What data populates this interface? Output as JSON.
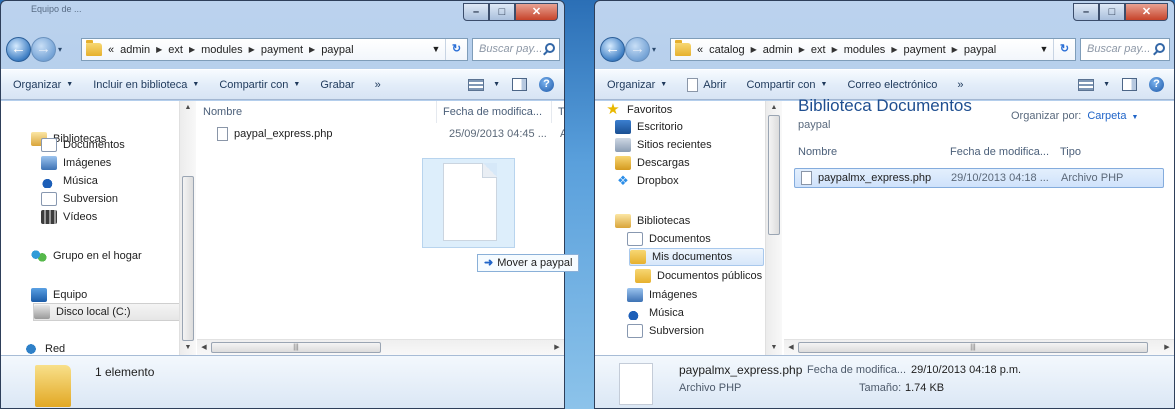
{
  "left": {
    "title": "Equipo de ... ",
    "address": {
      "prefix": "«",
      "crumbs": [
        "admin",
        "ext",
        "modules",
        "payment",
        "paypal"
      ]
    },
    "search_placeholder": "Buscar pay...",
    "toolbar": {
      "organize": "Organizar",
      "include": "Incluir en biblioteca",
      "share": "Compartir con",
      "burn": "Grabar",
      "more": "»"
    },
    "nav": {
      "libraries": "Bibliotecas",
      "documents": "Documentos",
      "images": "Imágenes",
      "music": "Música",
      "subversion": "Subversion",
      "videos": "Vídeos",
      "homegroup": "Grupo en el hogar",
      "computer": "Equipo",
      "local_disk": "Disco local (C:)",
      "network": "Red"
    },
    "columns": {
      "name": "Nombre",
      "modified": "Fecha de modifica...",
      "type": "Tip"
    },
    "files": [
      {
        "name": "paypal_express.php",
        "modified": "25/09/2013 04:45 ...",
        "type": "Ar"
      }
    ],
    "status": "1 elemento",
    "drag_tooltip": "Mover a paypal"
  },
  "right": {
    "address": {
      "prefix": "«",
      "crumbs": [
        "catalog",
        "admin",
        "ext",
        "modules",
        "payment",
        "paypal"
      ]
    },
    "search_placeholder": "Buscar pay...",
    "toolbar": {
      "organize": "Organizar",
      "open": "Abrir",
      "share": "Compartir con",
      "email": "Correo electrónico",
      "more": "»"
    },
    "nav": {
      "favorites": "Favoritos",
      "desktop": "Escritorio",
      "recent": "Sitios recientes",
      "downloads": "Descargas",
      "dropbox": "Dropbox",
      "libraries": "Bibliotecas",
      "documents": "Documentos",
      "my_documents": "Mis documentos",
      "public_documents": "Documentos públicos",
      "images": "Imágenes",
      "music": "Música",
      "subversion": "Subversion"
    },
    "library": {
      "title": "Biblioteca Documentos",
      "subtitle": "paypal",
      "arrange_label": "Organizar por:",
      "arrange_value": "Carpeta"
    },
    "columns": {
      "name": "Nombre",
      "modified": "Fecha de modifica...",
      "type": "Tipo"
    },
    "files": [
      {
        "name": "paypalmx_express.php",
        "modified": "29/10/2013 04:18 ...",
        "type": "Archivo PHP"
      }
    ],
    "details": {
      "filename": "paypalmx_express.php",
      "modified_label": "Fecha de modifica...",
      "modified_value": "29/10/2013 04:18 p.m.",
      "type": "Archivo PHP",
      "size_label": "Tamaño:",
      "size_value": "1.74 KB"
    }
  }
}
